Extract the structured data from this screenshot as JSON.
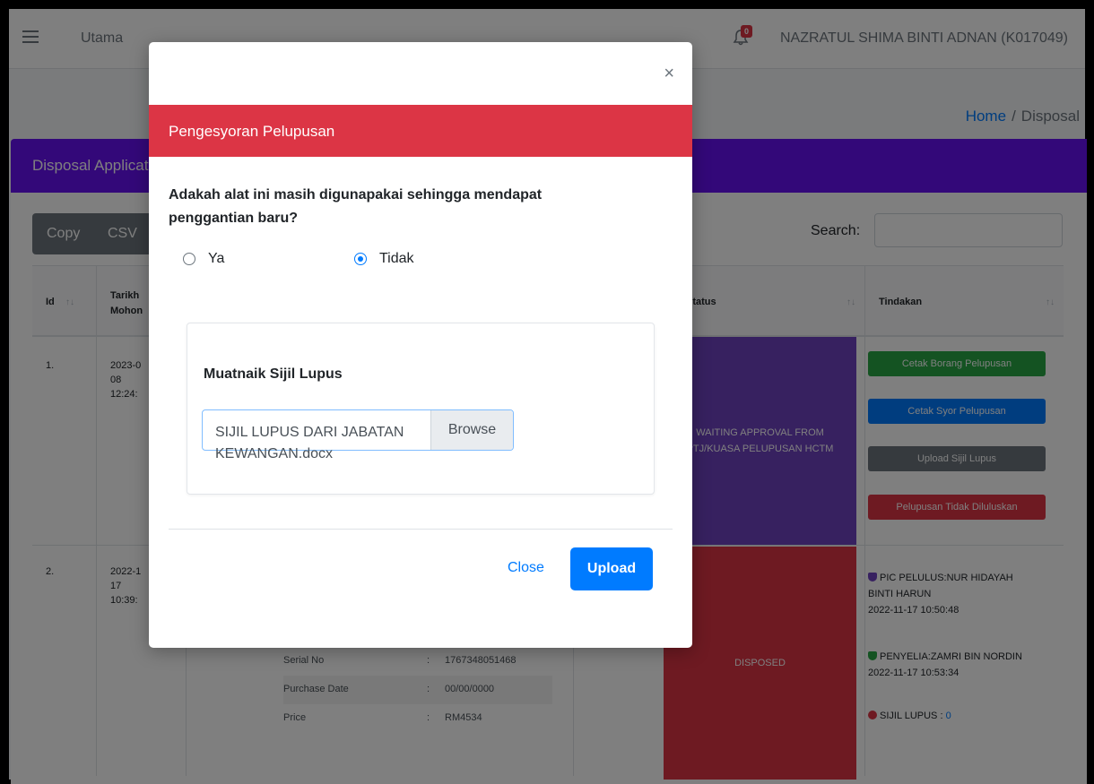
{
  "navbar": {
    "menu_label": "Utama",
    "notification_count": "0",
    "user_name": "NAZRATUL SHIMA BINTI ADNAN (K017049)"
  },
  "breadcrumb": {
    "home": "Home",
    "separator": "/",
    "current": "Disposal"
  },
  "card": {
    "title": "Disposal Application"
  },
  "toolbar": {
    "copy": "Copy",
    "csv": "CSV",
    "search_label": "Search:"
  },
  "table": {
    "headers": {
      "id": "Id",
      "tarikh_line1": "Tarikh",
      "tarikh_line2": "Mohon",
      "status": "Status",
      "tindakan": "Tindakan"
    },
    "rows": [
      {
        "id": "1.",
        "date_l1": "2023-0",
        "date_l2": "08",
        "date_l3": "12:24:",
        "status_l1": "WAITING APPROVAL FROM",
        "status_l2": "PTJ/KUASA PELUPUSAN HCTM",
        "actions": [
          "Cetak Borang Pelupusan",
          "Cetak Syor Pelupusan",
          "Upload Sijil Lupus",
          "Pelupusan Tidak Diluluskan"
        ]
      },
      {
        "id": "2.",
        "date_l1": "2022-1",
        "date_l2": "17",
        "date_l3": "10:39:",
        "status": "DISPOSED",
        "details": [
          {
            "key": "Serial No",
            "colon": ":",
            "value": "1767348051468"
          },
          {
            "key": "Purchase Date",
            "colon": ":",
            "value": "00/00/0000"
          },
          {
            "key": "Price",
            "colon": ":",
            "value": "RM4534"
          }
        ],
        "pic_pelulus_l1": "PIC PELULUS:NUR HIDAYAH",
        "pic_pelulus_l2": "BINTI HARUN",
        "pic_pelulus_time": "2022-11-17 10:50:48",
        "penyelia": "PENYELIA:ZAMRI BIN NORDIN",
        "penyelia_time": "2022-11-17 10:53:34",
        "sijil_label": "SIJIL LUPUS :",
        "sijil_value": "0"
      }
    ]
  },
  "modal": {
    "close_symbol": "×",
    "header": "Pengesyoran Pelupusan",
    "question_l1": "Adakah alat ini masih digunapakai sehingga mendapat",
    "question_l2": "penggantian baru?",
    "option_yes": "Ya",
    "option_no": "Tidak",
    "selected": "Tidak",
    "upload_title": "Muatnaik Sijil Lupus",
    "file_name_l1": "SIJIL LUPUS DARI JABATAN",
    "file_name_l2": "KEWANGAN.docx",
    "browse": "Browse",
    "close": "Close",
    "upload": "Upload"
  },
  "colors": {
    "modal_header": "#dc3545",
    "card_header": "#6610f2",
    "primary": "#007bff",
    "status_waiting": "#6f42c1",
    "status_disposed": "#dc3545"
  }
}
